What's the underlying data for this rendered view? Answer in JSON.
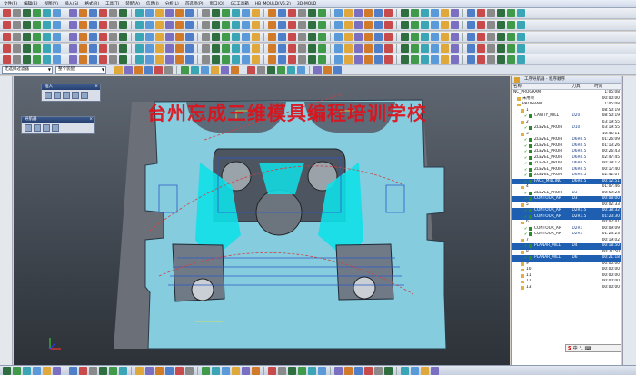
{
  "menubar": {
    "items": [
      "文件(F)",
      "编辑(E)",
      "视图(V)",
      "插入(S)",
      "格式(R)",
      "工具(T)",
      "装配(A)",
      "信息(I)",
      "分析(L)",
      "首选项(P)",
      "窗口(O)",
      "GC工具箱",
      "HB_MOULD(V5.2)",
      "3D-MOLD"
    ]
  },
  "filterbar": {
    "type_filter": "无选择过滤器",
    "scope_filter": "整个装配"
  },
  "palettes": {
    "insert_title": "插入",
    "navigator_title": "导航器"
  },
  "watermark": "台州忘成三维模具编程培训学校",
  "navigator": {
    "title": "工序导航器 - 程序顺序",
    "headers": {
      "name": "名称",
      "tool": "刀具",
      "time": "时间"
    },
    "rows": [
      {
        "name": "NC_PROGRAM",
        "tool": "",
        "time": "1:05:08",
        "icon": "none",
        "indent": 0,
        "selected": false
      },
      {
        "name": "未用项",
        "tool": "",
        "time": "00:00:00",
        "icon": "grp",
        "indent": 1,
        "selected": false
      },
      {
        "name": "PROGRAM",
        "tool": "",
        "time": "1:05:08",
        "icon": "grp",
        "indent": 1,
        "selected": false
      },
      {
        "name": "1",
        "tool": "",
        "time": "08:50:19",
        "icon": "grp",
        "indent": 2,
        "selected": false
      },
      {
        "name": "CAVITY_MILL",
        "tool": "D20",
        "time": "08:50:19",
        "icon": "op",
        "indent": 3,
        "selected": false
      },
      {
        "name": "2",
        "tool": "",
        "time": "03:19:55",
        "icon": "grp",
        "indent": 2,
        "selected": false
      },
      {
        "name": "ZLEVEL_PROFI",
        "tool": "D10",
        "time": "03:19:55",
        "icon": "op",
        "indent": 3,
        "selected": false
      },
      {
        "name": "3",
        "tool": "",
        "time": "10:45:11",
        "icon": "grp",
        "indent": 2,
        "selected": false
      },
      {
        "name": "ZLEVEL_PROFI",
        "tool": "D6R0.5",
        "time": "01:26:09",
        "icon": "op",
        "indent": 3,
        "selected": false
      },
      {
        "name": "ZLEVEL_PROFI",
        "tool": "D6R0.5",
        "time": "01:13:26",
        "icon": "op",
        "indent": 3,
        "selected": false
      },
      {
        "name": "ZLEVEL_PROFI",
        "tool": "D6R0.5",
        "time": "00:26:43",
        "icon": "op",
        "indent": 3,
        "selected": false
      },
      {
        "name": "ZLEVEL_PROFI",
        "tool": "D6R0.5",
        "time": "02:47:45",
        "icon": "op",
        "indent": 3,
        "selected": false
      },
      {
        "name": "ZLEVEL_PROFI",
        "tool": "D6R0.5",
        "time": "00:28:12",
        "icon": "op",
        "indent": 3,
        "selected": false
      },
      {
        "name": "ZLEVEL_PROFI",
        "tool": "D6R0.5",
        "time": "00:17:40",
        "icon": "op",
        "indent": 3,
        "selected": false
      },
      {
        "name": "ZLEVEL_PROFI",
        "tool": "D6R0.5",
        "time": "02:42:07",
        "icon": "op",
        "indent": 3,
        "selected": false
      },
      {
        "name": "FACE_MILLING",
        "tool": "D6R0.5",
        "time": "00:12:51",
        "icon": "op",
        "indent": 3,
        "selected": true
      },
      {
        "name": "4",
        "tool": "",
        "time": "01:07:46",
        "icon": "grp",
        "indent": 2,
        "selected": false
      },
      {
        "name": "ZLEVEL_PROFI",
        "tool": "D3",
        "time": "00:59:24",
        "icon": "op",
        "indent": 3,
        "selected": false
      },
      {
        "name": "CONTOUR_AR",
        "tool": "D3",
        "time": "00:08:00",
        "icon": "op",
        "indent": 3,
        "selected": true
      },
      {
        "name": "5",
        "tool": "",
        "time": "00:02:33",
        "icon": "grp",
        "indent": 2,
        "selected": false
      },
      {
        "name": "CONTOUR_AR",
        "tool": "D2R1.5",
        "time": "00:38:32",
        "icon": "op",
        "indent": 3,
        "selected": true
      },
      {
        "name": "CONTOUR_AR",
        "tool": "D2R1.5",
        "time": "01:23:30",
        "icon": "op",
        "indent": 3,
        "selected": true
      },
      {
        "name": "6",
        "tool": "",
        "time": "00:02:41",
        "icon": "grp",
        "indent": 2,
        "selected": false
      },
      {
        "name": "CONTOUR_AR",
        "tool": "D2R1",
        "time": "00:09:09",
        "icon": "op",
        "indent": 3,
        "selected": false
      },
      {
        "name": "CONTOUR_AR",
        "tool": "D2R1",
        "time": "01:23:23",
        "icon": "op",
        "indent": 3,
        "selected": false
      },
      {
        "name": "7",
        "tool": "",
        "time": "00:19:02",
        "icon": "grp",
        "indent": 2,
        "selected": false
      },
      {
        "name": "PLANAR_MILL",
        "tool": "D4",
        "time": "00:18:50",
        "icon": "op",
        "indent": 3,
        "selected": true
      },
      {
        "name": "8",
        "tool": "",
        "time": "00:21:50",
        "icon": "grp",
        "indent": 2,
        "selected": false
      },
      {
        "name": "PLANAR_MILL",
        "tool": "D6",
        "time": "00:21:18",
        "icon": "op",
        "indent": 3,
        "selected": true
      },
      {
        "name": "9",
        "tool": "",
        "time": "00:00:00",
        "icon": "grp",
        "indent": 2,
        "selected": false
      },
      {
        "name": "10",
        "tool": "",
        "time": "00:00:00",
        "icon": "grp",
        "indent": 2,
        "selected": false
      },
      {
        "name": "11",
        "tool": "",
        "time": "00:00:00",
        "icon": "grp",
        "indent": 2,
        "selected": false
      },
      {
        "name": "12",
        "tool": "",
        "time": "00:00:00",
        "icon": "grp",
        "indent": 2,
        "selected": false
      },
      {
        "name": "13",
        "tool": "",
        "time": "00:00:00",
        "icon": "grp",
        "indent": 2,
        "selected": false
      }
    ]
  },
  "ime": {
    "s": "S",
    "zh": "中",
    "punct": "°,",
    "keyboard": "⌨"
  },
  "colors": {
    "part_surface": "#7fc9de",
    "toolpath_cyan": "#10e0e8",
    "selection_blue": "#1f5fb2",
    "watermark_red": "#e0101a"
  }
}
